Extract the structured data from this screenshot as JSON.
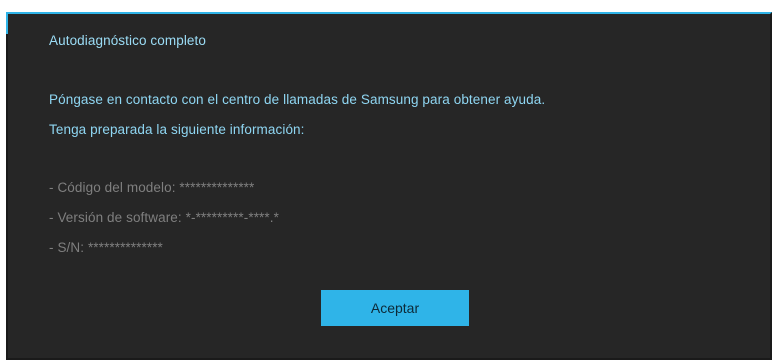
{
  "dialog": {
    "title": "Autodiagnóstico completo",
    "message_line1": "Póngase en contacto con el centro de llamadas de Samsung para obtener ayuda.",
    "message_line2": "Tenga preparada la siguiente información:",
    "info": [
      "- Código del modelo: **************",
      "- Versión de software: *-*********-****.*",
      "- S/N: **************"
    ],
    "accept_label": "Aceptar"
  },
  "colors": {
    "accent": "#2fb4e8",
    "background": "#262626",
    "text_primary": "#8fd6f2",
    "text_secondary": "#7f7f7f"
  }
}
